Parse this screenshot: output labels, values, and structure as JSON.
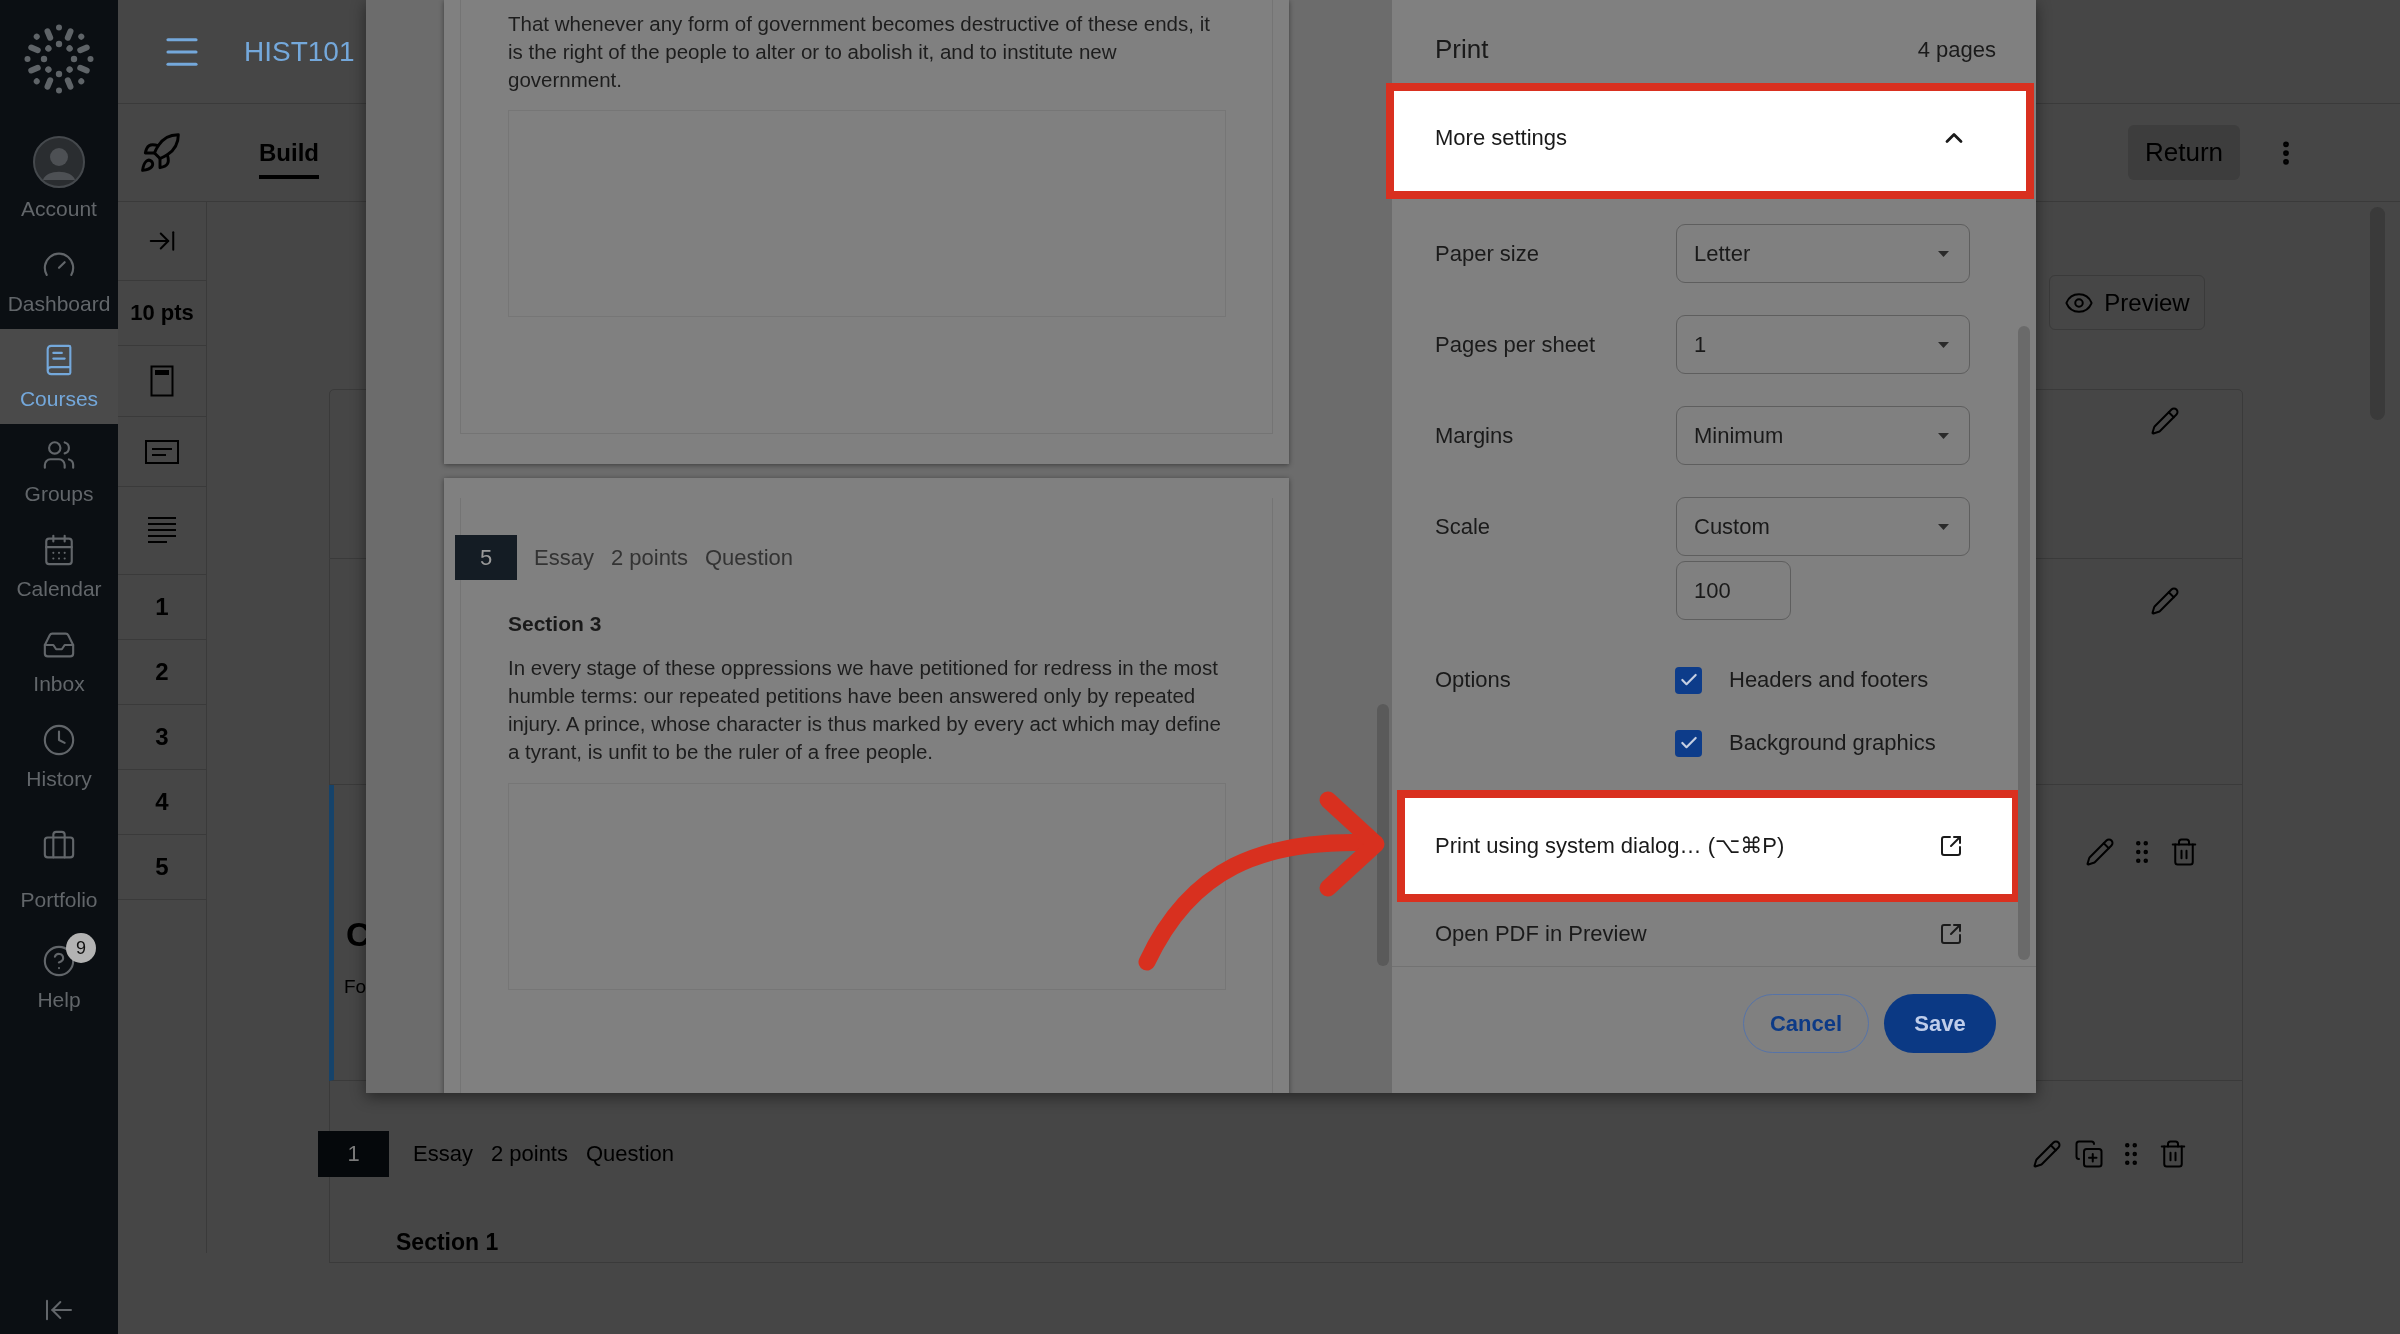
{
  "global_nav": {
    "items": [
      {
        "label": "Account",
        "selected": false
      },
      {
        "label": "Dashboard",
        "selected": false
      },
      {
        "label": "Courses",
        "selected": true
      },
      {
        "label": "Groups",
        "selected": false
      },
      {
        "label": "Calendar",
        "selected": false
      },
      {
        "label": "Inbox",
        "selected": false
      },
      {
        "label": "History",
        "selected": false
      },
      {
        "label": "Portfolio",
        "selected": false
      },
      {
        "label": "Help",
        "selected": false,
        "badge": "9"
      }
    ]
  },
  "top_bar": {
    "course": "HIST101"
  },
  "toolbar": {
    "tabs": [
      {
        "label": "Build",
        "selected": true
      }
    ],
    "return_button": "Return"
  },
  "tool_column": {
    "points": "10 pts",
    "questions": [
      "1",
      "2",
      "3",
      "4",
      "5"
    ]
  },
  "content": {
    "preview_button": "Preview",
    "cards": [
      {
        "kind": "block",
        "selected": false
      },
      {
        "kind": "block",
        "selected": false
      },
      {
        "kind": "text",
        "selected": true,
        "title": "C",
        "body": "Fo"
      },
      {
        "kind": "question",
        "selected": false,
        "number": "1",
        "type": "Essay",
        "points": "2 points",
        "label": "Question",
        "section": "Section 1"
      }
    ]
  },
  "print_dialog": {
    "title": "Print",
    "page_count": "4 pages",
    "more_settings": {
      "label": "More settings",
      "expanded": true,
      "highlighted": true
    },
    "settings": [
      {
        "label": "Paper size",
        "value": "Letter"
      },
      {
        "label": "Pages per sheet",
        "value": "1"
      },
      {
        "label": "Margins",
        "value": "Minimum"
      },
      {
        "label": "Scale",
        "value": "Custom",
        "custom_value": "100"
      }
    ],
    "options": {
      "label": "Options",
      "items": [
        {
          "label": "Headers and footers",
          "checked": true
        },
        {
          "label": "Background graphics",
          "checked": true
        }
      ]
    },
    "actions": [
      {
        "label": "Print using system dialog… (⌥⌘P)",
        "highlighted": true
      },
      {
        "label": "Open PDF in Preview",
        "highlighted": false
      }
    ],
    "buttons": [
      {
        "label": "Cancel",
        "kind": "secondary"
      },
      {
        "label": "Save",
        "kind": "primary"
      }
    ],
    "preview": {
      "pages": [
        {
          "kind": "continuation",
          "paragraph": "That whenever any form of government becomes destructive of these ends, it is the right of the people to alter or to abolish it, and to institute new government."
        },
        {
          "kind": "question",
          "number": "5",
          "type": "Essay",
          "points": "2 points",
          "label": "Question",
          "section": "Section 3",
          "paragraph": "In every stage of these oppressions we have petitioned for redress in the most humble terms: our repeated petitions have been answered only by repeated injury. A prince, whose character is thus marked by every act which may define a tyrant, is unfit to be the ruler of a free people."
        }
      ]
    }
  }
}
